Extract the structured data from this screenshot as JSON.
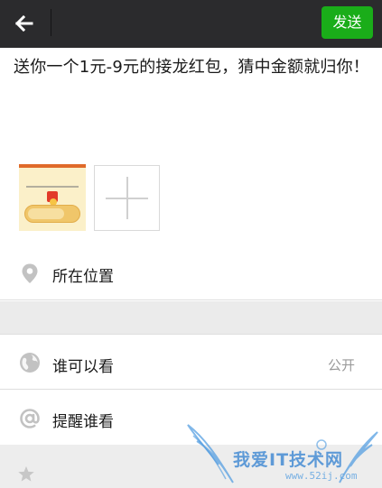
{
  "header": {
    "send_label": "发送"
  },
  "post": {
    "text": "送你一个1元-9元的接龙红包，猜中金额就归你！"
  },
  "settings": {
    "location_label": "所在位置",
    "visibility_label": "谁可以看",
    "visibility_value": "公开",
    "remind_label": "提醒谁看"
  },
  "watermark": {
    "text": "我爱IT技术网",
    "url": "www.52ij.com"
  },
  "colors": {
    "topbar": "#2b2b2d",
    "send_button": "#1aad19",
    "divider": "#dedede",
    "section_gap": "#ebebeb",
    "icon_gray": "#c2c2c2",
    "watermark_blue": "#2f7fd0"
  },
  "icons": {
    "back": "arrow-left-icon",
    "location": "location-pin-icon",
    "visibility": "globe-icon",
    "remind": "at-sign-icon",
    "star": "star-icon",
    "add": "plus-icon"
  }
}
